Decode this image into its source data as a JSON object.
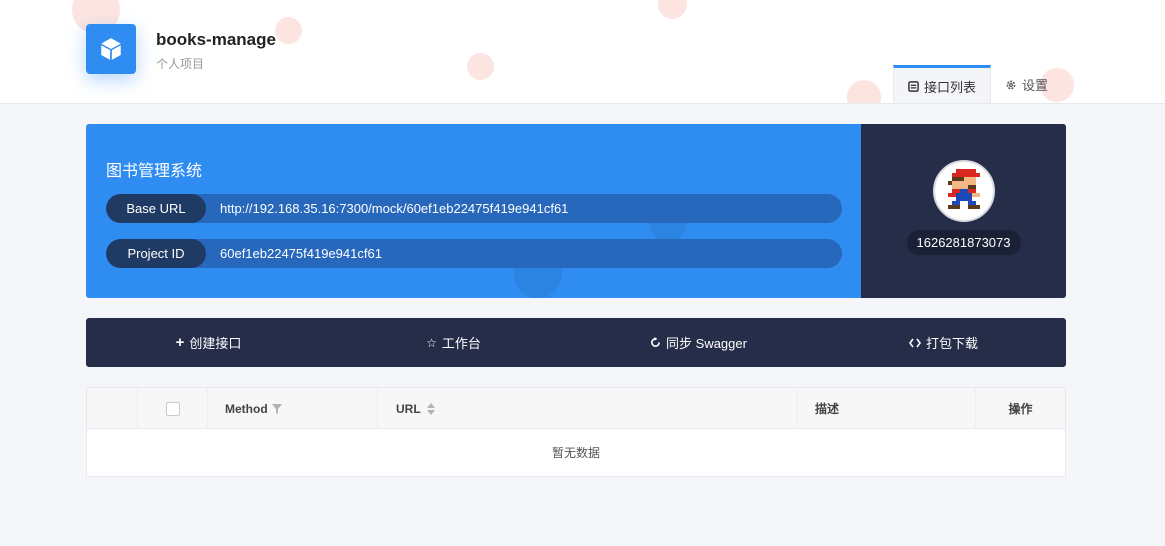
{
  "header": {
    "project_name": "books-manage",
    "project_type": "个人项目",
    "logo_icon": "cube-icon",
    "tabs": [
      {
        "label": "接口列表",
        "icon": "list-icon",
        "active": true
      },
      {
        "label": "设置",
        "icon": "gear-icon",
        "active": false
      }
    ]
  },
  "info": {
    "title": "图书管理系统",
    "base_url_label": "Base URL",
    "base_url": "http://192.168.35.16:7300/mock/60ef1eb22475f419e941cf61",
    "project_id_label": "Project ID",
    "project_id": "60ef1eb22475f419e941cf61",
    "user_id": "1626281873073",
    "accent_color": "#2f8cf0",
    "panel_color": "#252d48"
  },
  "toolbar": {
    "create": "创建接口",
    "workbench": "工作台",
    "sync": "同步 Swagger",
    "download": "打包下载"
  },
  "table": {
    "columns": [
      "Method",
      "URL",
      "描述",
      "操作"
    ],
    "empty_text": "暂无数据"
  }
}
